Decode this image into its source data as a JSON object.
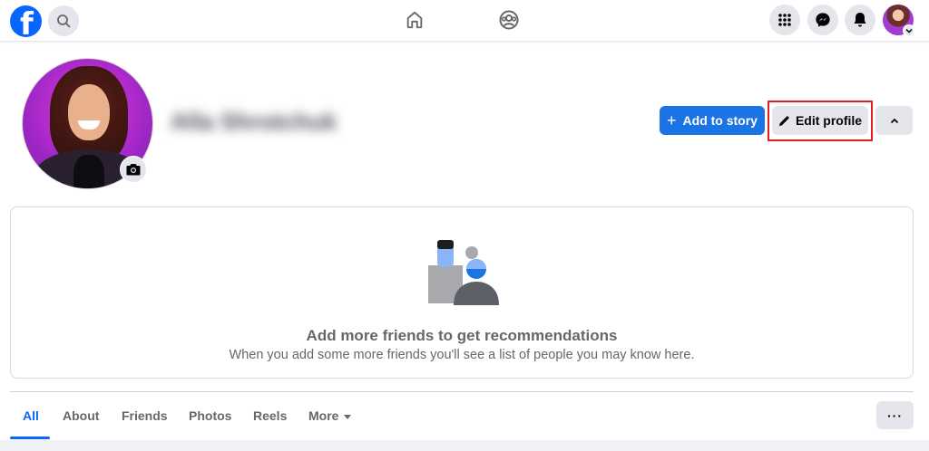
{
  "nav": {
    "logo_letter": "f",
    "icons": [
      "facebook-logo",
      "search-icon",
      "home-icon",
      "groups-icon",
      "menu-grid-icon",
      "messenger-icon",
      "bell-icon",
      "avatar",
      "chevron-down-icon"
    ]
  },
  "profile": {
    "name_blurred": "Alla Shrotchuk",
    "add_story_label": "Add to story",
    "edit_profile_label": "Edit profile"
  },
  "recommendations": {
    "title": "Add more friends to get recommendations",
    "subtitle": "When you add some more friends you'll see a list of people you may know here."
  },
  "tabs": {
    "all": "All",
    "about": "About",
    "friends": "Friends",
    "photos": "Photos",
    "reels": "Reels",
    "more": "More",
    "dots": "···"
  },
  "colors": {
    "accent": "#0866ff",
    "button_primary": "#1b74e4",
    "button_secondary": "#e4e6eb",
    "highlight_box": "#e0211b"
  }
}
